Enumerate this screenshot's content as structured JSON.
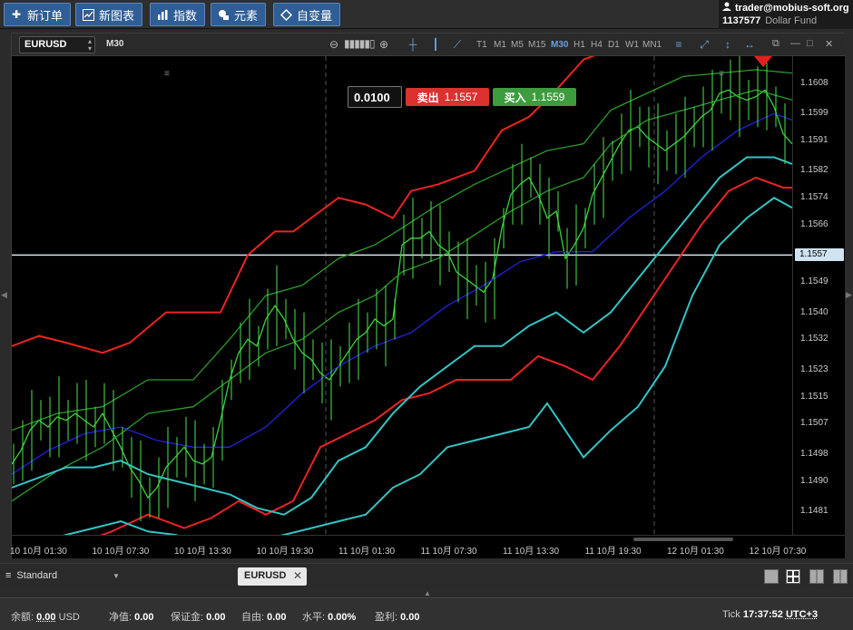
{
  "toolbar": {
    "buttons": [
      {
        "label": "新订单",
        "icon": "plus-icon"
      },
      {
        "label": "新图表",
        "icon": "chart-icon"
      },
      {
        "label": "指数",
        "icon": "indicator-icon"
      },
      {
        "label": "元素",
        "icon": "shapes-icon"
      },
      {
        "label": "自变量",
        "icon": "diamond-icon"
      }
    ]
  },
  "account": {
    "email": "trader@mobius-soft.org",
    "number": "1137577",
    "fund": "Dollar Fund"
  },
  "chart_header": {
    "symbol": "EURUSD",
    "timeframe": "M30",
    "timeframes": [
      "T1",
      "M1",
      "M5",
      "M15",
      "M30",
      "H1",
      "H4",
      "D1",
      "W1",
      "MN1"
    ],
    "active_timeframe": "M30"
  },
  "trade": {
    "lot": "0.0100",
    "sell_label": "卖出",
    "sell_price": "1.1557",
    "buy_label": "买入",
    "buy_price": "1.1559"
  },
  "chart_data": {
    "type": "line",
    "symbol": "EURUSD",
    "y_ticks": [
      "1.1608",
      "1.1599",
      "1.1591",
      "1.1582",
      "1.1574",
      "1.1566",
      "1.1557",
      "1.1549",
      "1.1540",
      "1.1532",
      "1.1523",
      "1.1515",
      "1.1507",
      "1.1498",
      "1.1490",
      "1.1481"
    ],
    "current_price": "1.1557",
    "x_ticks": [
      "10 10月 01:30",
      "10 10月 07:30",
      "10 10月 13:30",
      "10 10月 19:30",
      "11 10月 01:30",
      "11 10月 07:30",
      "11 10月 13:30",
      "11 10月 19:30",
      "12 10月 01:30",
      "12 10月 07:30"
    ],
    "ylim": [
      1.1474,
      1.1616
    ],
    "series": [
      {
        "color": "#3cd03c",
        "x": [
          0,
          10,
          20,
          30,
          40,
          50,
          60,
          70,
          80,
          90,
          100,
          110,
          120,
          130,
          140,
          150,
          160,
          170,
          180,
          190,
          200,
          210,
          220,
          230,
          240,
          250,
          260,
          270,
          280,
          290,
          300,
          310,
          320,
          330,
          340,
          350,
          360,
          370,
          380,
          390,
          400,
          410,
          420,
          430,
          440,
          450,
          460,
          470,
          480,
          490,
          500,
          510,
          520,
          530,
          540,
          550,
          560,
          570,
          580,
          590,
          600,
          610,
          620,
          630,
          640,
          650,
          660,
          670,
          680,
          690,
          700,
          710,
          720,
          730,
          740,
          750,
          760,
          770,
          780,
          790,
          800,
          810,
          820,
          830,
          840,
          850,
          860
        ],
        "values": [
          1.1495,
          1.1499,
          1.1505,
          1.1508,
          1.1506,
          1.1509,
          1.1508,
          1.151,
          1.1508,
          1.1506,
          1.151,
          1.1505,
          1.15,
          1.1494,
          1.149,
          1.1485,
          1.1488,
          1.1494,
          1.1497,
          1.15,
          1.1496,
          1.1495,
          1.1497,
          1.1508,
          1.152,
          1.1528,
          1.1532,
          1.153,
          1.1538,
          1.1542,
          1.1538,
          1.1532,
          1.1528,
          1.1526,
          1.1522,
          1.152,
          1.1524,
          1.1528,
          1.1532,
          1.1534,
          1.1538,
          1.1536,
          1.1538,
          1.156,
          1.1562,
          1.1562,
          1.1564,
          1.156,
          1.1558,
          1.1552,
          1.155,
          1.1548,
          1.1546,
          1.155,
          1.1565,
          1.1575,
          1.1578,
          1.158,
          1.1575,
          1.1568,
          1.157,
          1.1556,
          1.156,
          1.1565,
          1.1575,
          1.158,
          1.1585,
          1.159,
          1.1594,
          1.1595,
          1.1592,
          1.159,
          1.1588,
          1.159,
          1.1592,
          1.1595,
          1.1598,
          1.16,
          1.1605,
          1.1606,
          1.1604,
          1.1603,
          1.1604,
          1.1606,
          1.1601,
          1.1593,
          1.159
        ]
      },
      {
        "color": "#2222dd",
        "x": [
          0,
          40,
          80,
          120,
          160,
          200,
          240,
          280,
          320,
          360,
          400,
          440,
          480,
          520,
          560,
          600,
          640,
          680,
          720,
          760,
          800,
          840,
          860
        ],
        "values": [
          1.1492,
          1.1499,
          1.1504,
          1.1506,
          1.1502,
          1.15,
          1.15,
          1.1506,
          1.1516,
          1.1524,
          1.153,
          1.1534,
          1.1542,
          1.1548,
          1.1555,
          1.1558,
          1.1558,
          1.1568,
          1.1576,
          1.1586,
          1.1594,
          1.1599,
          1.1597
        ]
      },
      {
        "color": "#ee2222",
        "x": [
          0,
          30,
          60,
          100,
          130,
          170,
          200,
          230,
          260,
          290,
          310,
          340,
          360,
          390,
          420,
          440,
          470,
          510,
          540,
          570,
          600,
          630,
          660,
          690,
          720,
          760,
          800,
          840,
          860
        ],
        "values": [
          1.153,
          1.1533,
          1.1531,
          1.1528,
          1.1531,
          1.154,
          1.154,
          1.154,
          1.1557,
          1.1564,
          1.1564,
          1.157,
          1.1574,
          1.1572,
          1.1568,
          1.1576,
          1.1578,
          1.1582,
          1.1594,
          1.1598,
          1.1606,
          1.1615,
          1.1618,
          1.162,
          1.1622,
          1.1625,
          1.1625,
          1.1624,
          1.1622
        ]
      },
      {
        "color": "#ee2222",
        "x": [
          0,
          40,
          80,
          110,
          150,
          190,
          220,
          250,
          280,
          310,
          340,
          370,
          400,
          430,
          460,
          490,
          520,
          550,
          580,
          610,
          640,
          670,
          700,
          730,
          760,
          790,
          820,
          850,
          860
        ],
        "values": [
          1.1466,
          1.1468,
          1.1472,
          1.1475,
          1.148,
          1.1476,
          1.1479,
          1.1484,
          1.148,
          1.1484,
          1.15,
          1.1504,
          1.1508,
          1.1514,
          1.1516,
          1.152,
          1.152,
          1.152,
          1.1527,
          1.1524,
          1.152,
          1.153,
          1.1542,
          1.1554,
          1.1566,
          1.1576,
          1.158,
          1.1577,
          1.1577
        ]
      },
      {
        "color": "#2a9d2a",
        "x": [
          0,
          50,
          100,
          150,
          200,
          240,
          280,
          320,
          360,
          400,
          430,
          470,
          510,
          550,
          590,
          630,
          660,
          700,
          740,
          780,
          820,
          860
        ],
        "values": [
          1.1505,
          1.151,
          1.1512,
          1.152,
          1.152,
          1.1532,
          1.1545,
          1.1548,
          1.1556,
          1.156,
          1.1565,
          1.1572,
          1.1578,
          1.1583,
          1.1588,
          1.159,
          1.16,
          1.1605,
          1.161,
          1.1611,
          1.1612,
          1.1611
        ]
      },
      {
        "color": "#2a9d2a",
        "x": [
          0,
          50,
          100,
          150,
          200,
          240,
          280,
          320,
          360,
          400,
          430,
          470,
          510,
          550,
          590,
          630,
          660,
          700,
          740,
          780,
          820,
          860
        ],
        "values": [
          1.1484,
          1.1493,
          1.15,
          1.151,
          1.1512,
          1.152,
          1.1528,
          1.1532,
          1.154,
          1.1545,
          1.1552,
          1.1556,
          1.1563,
          1.157,
          1.1576,
          1.158,
          1.159,
          1.1597,
          1.16,
          1.1603,
          1.1606,
          1.1603
        ]
      },
      {
        "color": "#33c4c4",
        "x": [
          0,
          30,
          60,
          90,
          120,
          150,
          180,
          210,
          240,
          270,
          300,
          330,
          360,
          390,
          420,
          450,
          480,
          510,
          540,
          570,
          600,
          630,
          660,
          690,
          720,
          750,
          780,
          810,
          840,
          860
        ],
        "values": [
          1.1488,
          1.1491,
          1.1494,
          1.1494,
          1.1496,
          1.1492,
          1.149,
          1.1488,
          1.1486,
          1.1482,
          1.148,
          1.1485,
          1.1496,
          1.15,
          1.151,
          1.1518,
          1.1524,
          1.153,
          1.153,
          1.1536,
          1.154,
          1.1534,
          1.154,
          1.155,
          1.156,
          1.157,
          1.158,
          1.1586,
          1.1586,
          1.1584
        ]
      },
      {
        "color": "#33c4c4",
        "x": [
          0,
          30,
          60,
          90,
          120,
          150,
          180,
          210,
          240,
          270,
          300,
          330,
          360,
          390,
          420,
          450,
          480,
          510,
          540,
          570,
          590,
          610,
          630,
          660,
          690,
          720,
          750,
          780,
          810,
          840,
          860
        ],
        "values": [
          1.147,
          1.1472,
          1.1474,
          1.1476,
          1.1478,
          1.1475,
          1.1474,
          1.1472,
          1.147,
          1.1472,
          1.1474,
          1.1476,
          1.1478,
          1.148,
          1.1488,
          1.1492,
          1.15,
          1.1502,
          1.1504,
          1.1506,
          1.1513,
          1.1505,
          1.1497,
          1.1505,
          1.1512,
          1.1524,
          1.1545,
          1.156,
          1.1568,
          1.1574,
          1.1571
        ]
      }
    ]
  },
  "tabs": {
    "workspace": "Standard",
    "active_tab": "EURUSD"
  },
  "status": {
    "balance_label": "余额:",
    "balance_value": "0.00",
    "balance_currency": "USD",
    "equity_label": "净值:",
    "equity_value": "0.00",
    "margin_label": "保证金:",
    "margin_value": "0.00",
    "free_label": "自由:",
    "free_value": "0.00",
    "level_label": "水平:",
    "level_value": "0.00%",
    "profit_label": "盈利:",
    "profit_value": "0.00",
    "tick_label": "Tick",
    "time": "17:37:52",
    "timezone": "UTC+3"
  }
}
